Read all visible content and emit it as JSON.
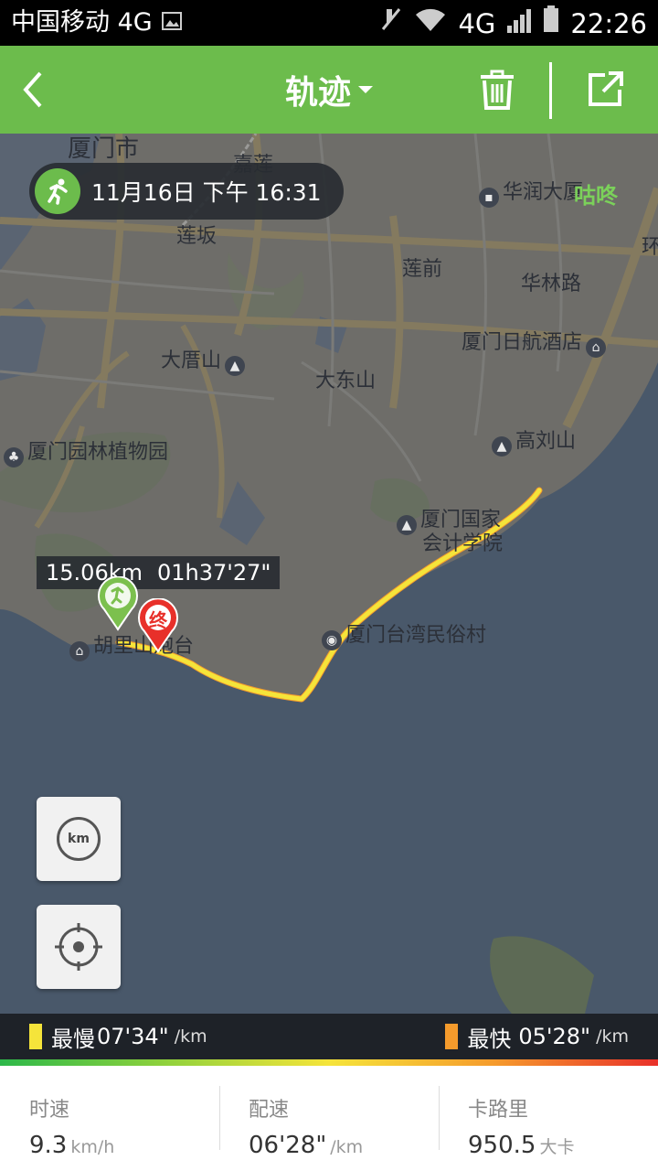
{
  "status_bar": {
    "carrier": "中国移动 4G",
    "network": "4G",
    "time": "22:26"
  },
  "header": {
    "title": "轨迹",
    "icons": [
      "back-icon",
      "chevron-down-icon",
      "trash-icon",
      "share-icon"
    ]
  },
  "map": {
    "brand": "咕咚",
    "date_time": "11月16日 下午 16:31",
    "distance": "15.06km",
    "duration": "01h37'27\"",
    "end_marker": "终",
    "labels": {
      "city": "厦门市",
      "jialian": "嘉莲",
      "lianban": "莲坂",
      "huarun": "华润大厦",
      "lianqian": "莲前",
      "hualin": "华林路",
      "huan": "环",
      "riyue": "厦门日航酒店",
      "dadeng": "大厝山",
      "dadong": "大东山",
      "garden": "厦门园林植物园",
      "gaoliu": "高刘山",
      "guojia1": "厦门国家",
      "guojia2": "会计学院",
      "taiwan": "厦门台湾民俗村",
      "hulishan": "胡里山炮台"
    }
  },
  "pace_legend": {
    "slowest_label": "最慢",
    "slowest_value": "07'34\"",
    "fastest_label": "最快",
    "fastest_value": "05'28\"",
    "unit": "/km",
    "slow_color": "#f5e43a",
    "fast_color": "#f59b2c"
  },
  "stats": [
    {
      "label": "时速",
      "value": "9.3",
      "unit": "km/h"
    },
    {
      "label": "配速",
      "value": "06'28\"",
      "unit": "/km"
    },
    {
      "label": "卡路里",
      "value": "950.5",
      "unit": "大卡"
    }
  ],
  "buttons": {
    "km_label": "km"
  },
  "colors": {
    "header_green": "#6cbc4c",
    "sea": "#49586a",
    "land": "#6f6f6c",
    "track": "#f5e43a"
  }
}
